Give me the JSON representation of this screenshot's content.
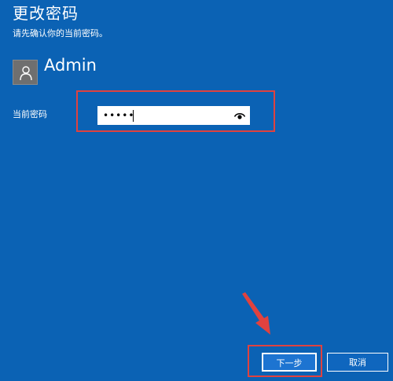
{
  "page": {
    "title": "更改密码",
    "subtitle": "请先确认你的当前密码。"
  },
  "user": {
    "name": "Admin",
    "avatar_icon": "user-silhouette-icon"
  },
  "password": {
    "label": "当前密码",
    "masked_value": "•••••",
    "reveal_icon": "eye-icon"
  },
  "buttons": {
    "next": "下一步",
    "cancel": "取消"
  },
  "colors": {
    "background": "#0b62b4",
    "highlight": "#e0423f",
    "button_primary": "#1d74d1",
    "text": "#ffffff"
  }
}
